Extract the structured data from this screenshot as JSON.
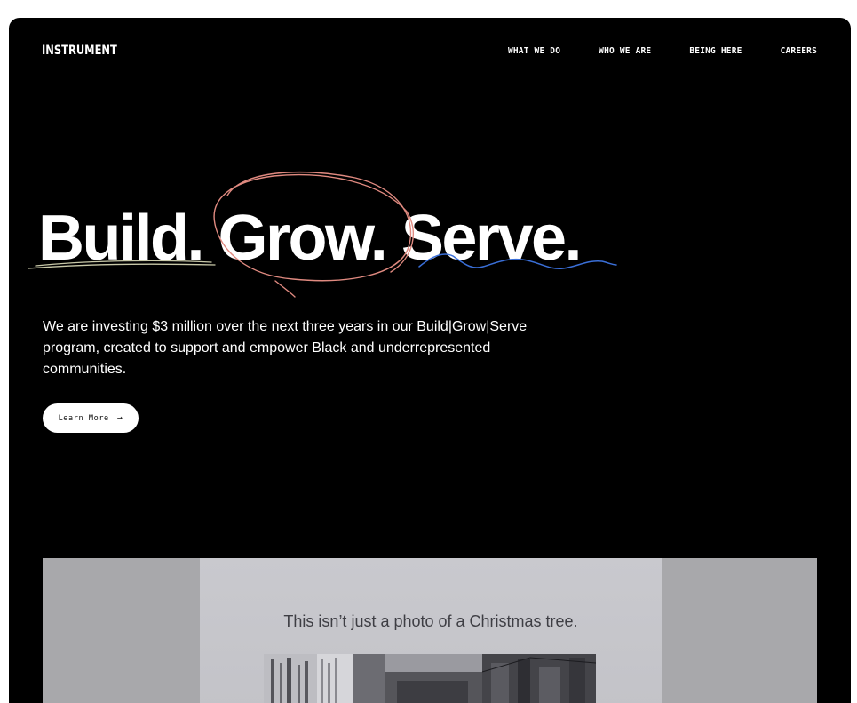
{
  "brand": {
    "logo": "INSTRUMENT"
  },
  "nav": {
    "items": [
      "WHAT WE DO",
      "WHO WE ARE",
      "BEING HERE",
      "CAREERS"
    ]
  },
  "hero": {
    "headline": "Build. Grow. Serve.",
    "lede": "We are investing $3 million over the next three years in our Build|Grow|Serve program, created to support and empower Black and underrepresented communities.",
    "cta": {
      "label": "Learn More",
      "icon": "arrow-right-icon",
      "arrow_glyph": "→"
    }
  },
  "media": {
    "caption": "This isn’t just a photo of a Christmas tree."
  },
  "colors": {
    "background": "#000000",
    "text": "#ffffff",
    "circle_scribble": "#e08a80",
    "wave_scribble": "#3a6fd8",
    "underline_scribble": "#c8c8a8"
  }
}
